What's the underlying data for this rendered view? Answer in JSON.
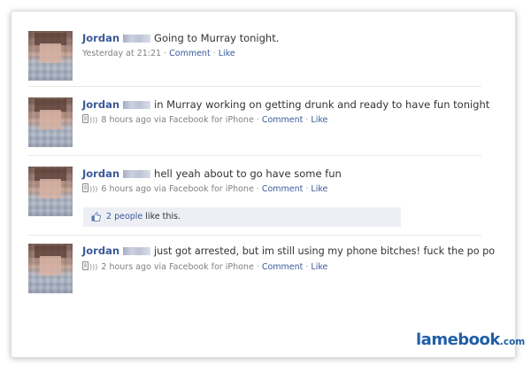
{
  "posts": [
    {
      "author": "Jordan",
      "text": "Going to Murray tonight.",
      "time": "Yesterday at 21:21",
      "via": "",
      "comment_label": "Comment",
      "like_label": "Like"
    },
    {
      "author": "Jordan",
      "text": "in Murray working on getting drunk and ready to have fun tonight",
      "time": "8 hours ago",
      "via": "via Facebook for iPhone",
      "comment_label": "Comment",
      "like_label": "Like"
    },
    {
      "author": "Jordan",
      "text": "hell yeah about to go have some fun",
      "time": "6 hours ago",
      "via": "via Facebook for iPhone",
      "comment_label": "Comment",
      "like_label": "Like",
      "likes": {
        "count_text": "2 people",
        "suffix": "like this."
      }
    },
    {
      "author": "Jordan",
      "text": "just got arrested, but im still using my phone bitches! fuck the po po",
      "time": "2 hours ago",
      "via": "via Facebook for iPhone",
      "comment_label": "Comment",
      "like_label": "Like"
    }
  ],
  "watermark": {
    "name": "lamebook",
    "tld": ".com"
  },
  "colors": {
    "link": "#3b5998",
    "meta": "#808080",
    "like_bg": "#edeff4",
    "logo": "#1f5fa8"
  }
}
